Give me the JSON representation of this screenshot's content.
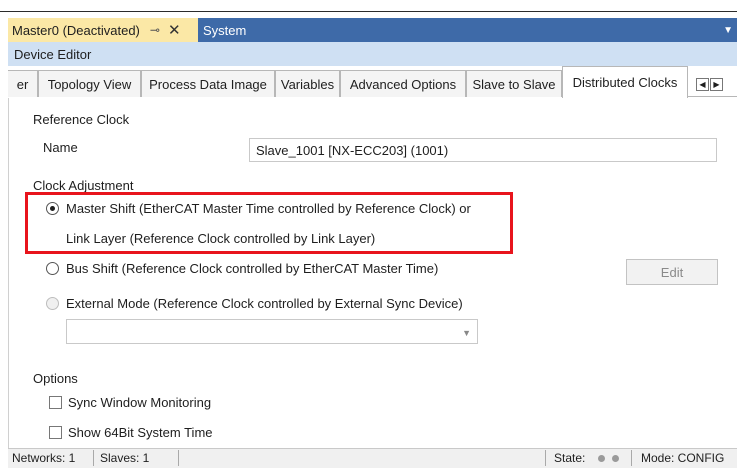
{
  "document_tabs": {
    "active": "Master0 (Deactivated)",
    "pin": "⊸",
    "close": "✕",
    "other": "System",
    "dropdown": "▼"
  },
  "editor": {
    "title": "Device Editor"
  },
  "tabs": [
    {
      "label": "er"
    },
    {
      "label": "Topology View"
    },
    {
      "label": "Process Data Image"
    },
    {
      "label": "Variables"
    },
    {
      "label": "Advanced Options"
    },
    {
      "label": "Slave to Slave"
    },
    {
      "label": "Distributed Clocks"
    }
  ],
  "tab_scroll": {
    "left": "◀",
    "right": "▶"
  },
  "reference_clock": {
    "section_label": "Reference Clock",
    "name_label": "Name",
    "name_value": "Slave_1001 [NX-ECC203] (1001)"
  },
  "clock_adjustment": {
    "section_label": "Clock Adjustment",
    "master_shift_line1": "Master Shift (EtherCAT Master Time controlled by Reference Clock) or",
    "master_shift_line2": "Link Layer (Reference Clock controlled by Link Layer)",
    "bus_shift": "Bus Shift (Reference Clock controlled by EtherCAT Master Time)",
    "external_mode": "External Mode (Reference Clock controlled by External Sync Device)",
    "edit_button": "Edit",
    "selected": "master_shift"
  },
  "options": {
    "section_label": "Options",
    "sync_window": "Sync Window Monitoring",
    "show_64bit": "Show 64Bit System Time"
  },
  "status_bar": {
    "networks": "Networks: 1",
    "slaves": "Slaves: 1",
    "state_label": "State:",
    "mode": "Mode: CONFIG"
  },
  "colors": {
    "document_bar": "#3e6aa8",
    "active_doc_tab": "#fbe8a6",
    "editor_header": "#cfe0f3",
    "highlight": "#e8141c"
  }
}
